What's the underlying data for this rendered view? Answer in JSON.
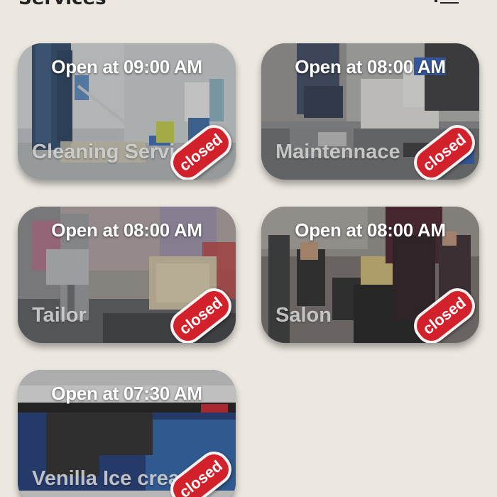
{
  "header": {
    "title": "Services",
    "menu_icon": "menu-icon"
  },
  "services": [
    {
      "name": "Cleaning Services",
      "open_label": "Open at 09:00 AM",
      "status": "closed"
    },
    {
      "name": "Maintennace",
      "open_label": "Open at 08:00 AM",
      "status": "closed"
    },
    {
      "name": "Tailor",
      "open_label": "Open at 08:00 AM",
      "status": "closed"
    },
    {
      "name": "Salon",
      "open_label": "Open at 08:00 AM",
      "status": "closed"
    },
    {
      "name": "Venilla Ice cream",
      "open_label": "Open at 07:30 AM",
      "status": "closed"
    }
  ],
  "colors": {
    "background": "#ece8e1",
    "badge": "#d3212b",
    "badge_border": "#f2f2f2"
  }
}
